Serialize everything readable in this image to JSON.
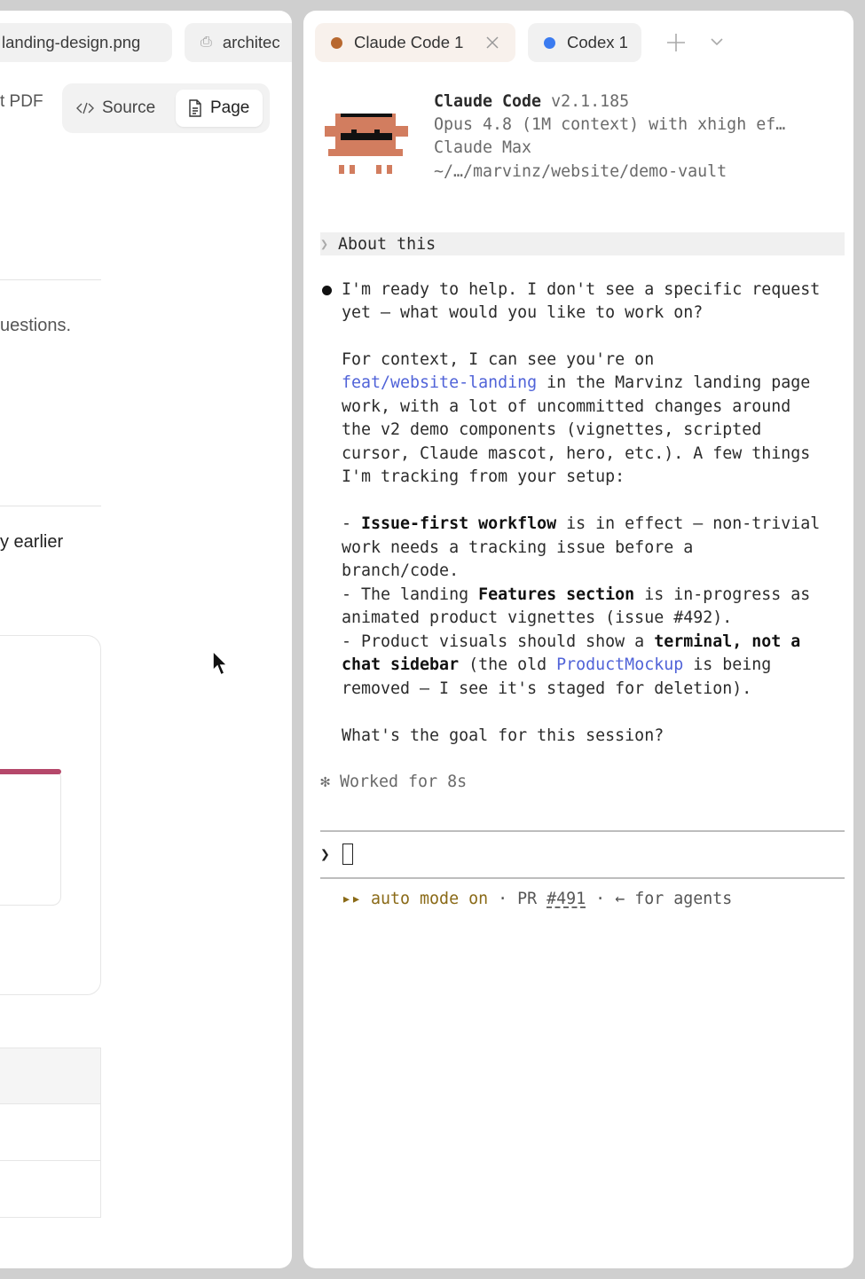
{
  "left_pane": {
    "tabs": [
      {
        "label": "landing-design.png"
      },
      {
        "label": "architec"
      }
    ],
    "pdf_label": "t PDF",
    "view_toggle": {
      "source_label": "Source",
      "page_label": "Page",
      "selected": "Page"
    },
    "fragments": {
      "questions": "uestions.",
      "earlier": "y earlier"
    },
    "accent_color": "#b5486a"
  },
  "right_pane": {
    "tabs": [
      {
        "label": "Claude Code 1",
        "dot_color": "#b8682f",
        "active": true
      },
      {
        "label": "Codex 1",
        "dot_color": "#3b7bf0",
        "active": false
      }
    ],
    "header": {
      "app_name": "Claude Code",
      "version": "v2.1.185",
      "model_line": "Opus 4.8 (1M context) with xhigh ef…",
      "plan": "Claude Max",
      "path": "~/…/marvinz/website/demo-vault"
    },
    "about_label": "About this",
    "message": {
      "intro_1": "I'm ready to help. I don't see a specific request",
      "intro_2": "yet — what would you like to work on?",
      "ctx_1": "For context, I can see you're on",
      "branch": "feat/website-landing",
      "ctx_2_rest": " in the Marvinz landing page",
      "ctx_3": "work, with a lot of uncommitted changes around",
      "ctx_4": "the v2 demo components (vignettes, scripted",
      "ctx_5": "cursor, Claude mascot, hero, etc.). A few things",
      "ctx_6": "I'm tracking from your setup:",
      "b1_prefix": "- ",
      "b1_bold": "Issue-first workflow",
      "b1_rest": " is in effect — non-trivial",
      "b1_l2": "work needs a tracking issue before a",
      "b1_l3": "branch/code.",
      "b2_prefix": "- The landing ",
      "b2_bold": "Features section",
      "b2_rest": " is in-progress as",
      "b2_l2": "animated product vignettes (issue #492).",
      "b3_prefix": "- Product visuals should show a ",
      "b3_bold": "terminal, not a",
      "b3_l2_bold": "chat sidebar",
      "b3_l2_mid": " (the old ",
      "b3_link": "ProductMockup",
      "b3_l2_rest": " is being",
      "b3_l3": "removed — I see it's staged for deletion).",
      "question": "What's the goal for this session?"
    },
    "worked": "✻ Worked for 8s",
    "prompt_caret": "❯",
    "status": {
      "auto_mode": "▸▸ auto mode on",
      "sep1": " · PR ",
      "pr_number": "#491",
      "sep2": " · ← for agents"
    },
    "colors": {
      "link": "#5063d8",
      "auto_mode": "#8a6a17",
      "mascot": "#d27d5f"
    }
  }
}
